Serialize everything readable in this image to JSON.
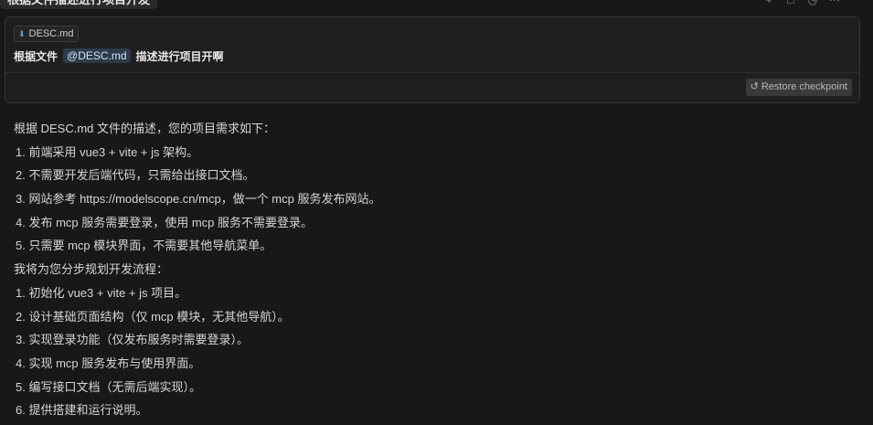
{
  "top": {
    "title": "根据文件描述进行项目开发",
    "actions": [
      "add-icon",
      "new-chat-icon",
      "history-icon",
      "more-icon"
    ]
  },
  "prompt": {
    "file_chip": "DESC.md",
    "text_before": "根据文件",
    "mention": "@DESC.md",
    "text_after": "描述进行项目开啊",
    "restore_label": "Restore checkpoint"
  },
  "response": {
    "intro": "根据 DESC.md 文件的描述，您的项目需求如下：",
    "requirements": [
      "1. 前端采用 vue3 + vite + js 架构。",
      "2. 不需要开发后端代码，只需给出接口文档。",
      "3. 网站参考 https://modelscope.cn/mcp，做一个 mcp 服务发布网站。",
      "4. 发布 mcp 服务需要登录，使用 mcp 服务不需要登录。",
      "5. 只需要 mcp 模块界面，不需要其他导航菜单。"
    ],
    "plan_intro": "我将为您分步规划开发流程：",
    "steps": [
      "1. 初始化 vue3 + vite + js 项目。",
      "2. 设计基础页面结构（仅 mcp 模块，无其他导航）。",
      "3. 实现登录功能（仅发布服务时需要登录）。",
      "4. 实现 mcp 服务发布与使用界面。",
      "5. 编写接口文档（无需后端实现）。",
      "6. 提供搭建和运行说明。"
    ]
  }
}
